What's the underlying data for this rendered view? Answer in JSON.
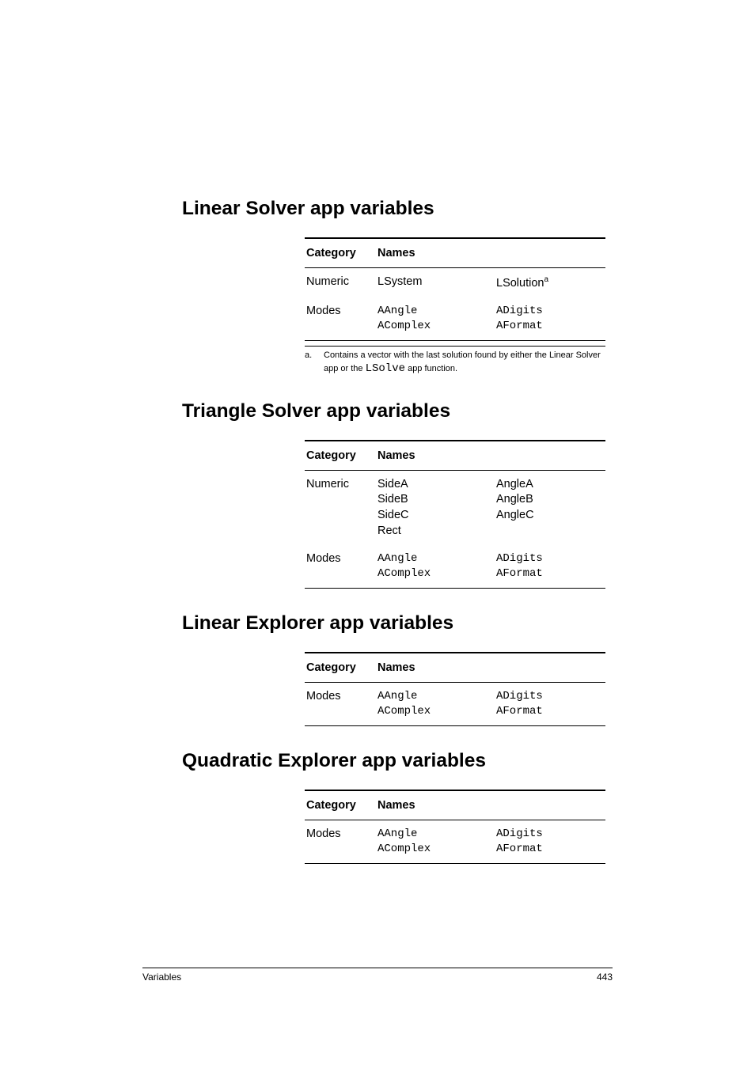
{
  "sections": {
    "linear_solver": {
      "title": "Linear Solver app variables",
      "header_category": "Category",
      "header_names": "Names",
      "rows": {
        "numeric": {
          "cat": "Numeric",
          "n1": "LSystem",
          "n2_text": "LSolution",
          "n2_sup": "a",
          "n2_is_mono": false
        },
        "modes": {
          "cat": "Modes",
          "n1_line1": "AAngle",
          "n1_line2": "AComplex",
          "n2_line1": "ADigits",
          "n2_line2": "AFormat"
        }
      },
      "footnote": {
        "label": "a.",
        "text_pre": "Contains a vector with the last solution found by either the Linear Solver app or the ",
        "code": "LSolve",
        "text_post": " app function."
      }
    },
    "triangle_solver": {
      "title": "Triangle Solver app variables",
      "header_category": "Category",
      "header_names": "Names",
      "rows": {
        "numeric": {
          "cat": "Numeric",
          "n1_line1": "SideA",
          "n1_line2": "SideB",
          "n1_line3": "SideC",
          "n1_line4": "Rect",
          "n2_line1": "AngleA",
          "n2_line2": "AngleB",
          "n2_line3": "AngleC"
        },
        "modes": {
          "cat": "Modes",
          "n1_line1": "AAngle",
          "n1_line2": "AComplex",
          "n2_line1": "ADigits",
          "n2_line2": "AFormat"
        }
      }
    },
    "linear_explorer": {
      "title": "Linear Explorer app variables",
      "header_category": "Category",
      "header_names": "Names",
      "rows": {
        "modes": {
          "cat": "Modes",
          "n1_line1": "AAngle",
          "n1_line2": "AComplex",
          "n2_line1": "ADigits",
          "n2_line2": "AFormat"
        }
      }
    },
    "quadratic_explorer": {
      "title": "Quadratic Explorer app variables",
      "header_category": "Category",
      "header_names": "Names",
      "rows": {
        "modes": {
          "cat": "Modes",
          "n1_line1": "AAngle",
          "n1_line2": "AComplex",
          "n2_line1": "ADigits",
          "n2_line2": "AFormat"
        }
      }
    }
  },
  "footer": {
    "left": "Variables",
    "right": "443"
  }
}
